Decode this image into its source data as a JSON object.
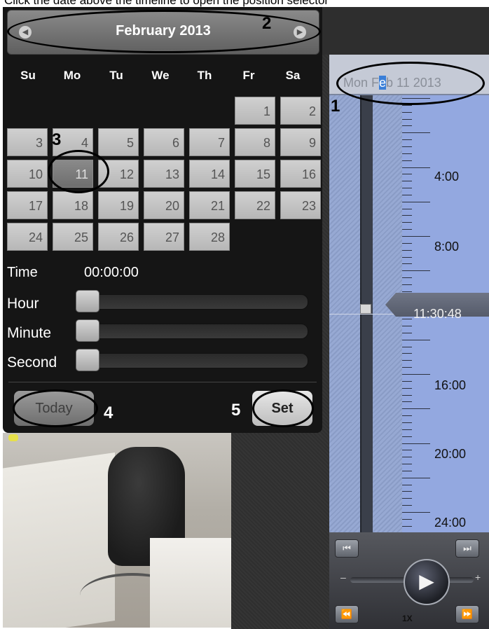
{
  "caption": "Click the date above the timeline to open the position selector",
  "timeline": {
    "date": "Mon Feb 11 2013",
    "labels": [
      "4:00",
      "8:00",
      "16:00",
      "20:00",
      "24:00"
    ],
    "current_time": "11:30:48",
    "speed": "1X",
    "controls": {
      "skip_start_icon": "skip-to-start-icon",
      "skip_end_icon": "skip-to-end-icon",
      "rewind_icon": "rewind-icon",
      "fast_forward_icon": "fast-forward-icon",
      "play_icon": "play-icon",
      "minus": "–",
      "plus": "+"
    }
  },
  "picker": {
    "month_title": "February 2013",
    "weekdays": [
      "Su",
      "Mo",
      "Tu",
      "We",
      "Th",
      "Fr",
      "Sa"
    ],
    "days": [
      [
        "",
        "",
        "",
        "",
        "",
        "1",
        "2"
      ],
      [
        "3",
        "4",
        "5",
        "6",
        "7",
        "8",
        "9"
      ],
      [
        "10",
        "11",
        "12",
        "13",
        "14",
        "15",
        "16"
      ],
      [
        "17",
        "18",
        "19",
        "20",
        "21",
        "22",
        "23"
      ],
      [
        "24",
        "25",
        "26",
        "27",
        "28",
        "",
        ""
      ]
    ],
    "selected_day": "11",
    "time_label": "Time",
    "time_value": "00:00:00",
    "sliders": [
      {
        "label": "Hour",
        "value": 0
      },
      {
        "label": "Minute",
        "value": 0
      },
      {
        "label": "Second",
        "value": 0
      }
    ],
    "today_label": "Today",
    "set_label": "Set"
  },
  "annotations": [
    "1",
    "2",
    "3",
    "4",
    "5"
  ],
  "colors": {
    "timeline_scale": "#93a8e0",
    "picker_bg": "#151515",
    "day_cell": "#c4c4c4",
    "selected_day": "#7a7a7a"
  }
}
